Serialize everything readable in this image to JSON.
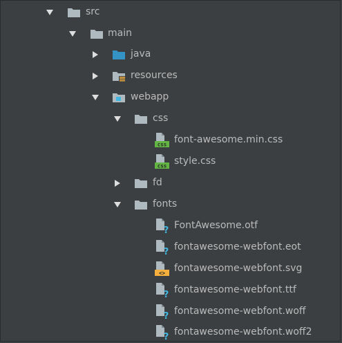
{
  "tree": {
    "src": "src",
    "main": "main",
    "java": "java",
    "resources": "resources",
    "webapp": "webapp",
    "css": "css",
    "css_files": [
      "font-awesome.min.css",
      "style.css"
    ],
    "fd": "fd",
    "fonts": "fonts",
    "font_files": [
      "FontAwesome.otf",
      "fontawesome-webfont.eot",
      "fontawesome-webfont.svg",
      "fontawesome-webfont.ttf",
      "fontawesome-webfont.woff",
      "fontawesome-webfont.woff2"
    ],
    "file_badges": {
      "css": "css",
      "svg": "<>",
      "unknown": "?"
    }
  },
  "colors": {
    "background": "#3c3f41",
    "text": "#bbbbbb",
    "folder": "#aeb9c0",
    "java_folder": "#3592c4",
    "css_badge": "#62b543",
    "svg_badge": "#f4af3d",
    "unknown_badge": "#40b6e0"
  }
}
